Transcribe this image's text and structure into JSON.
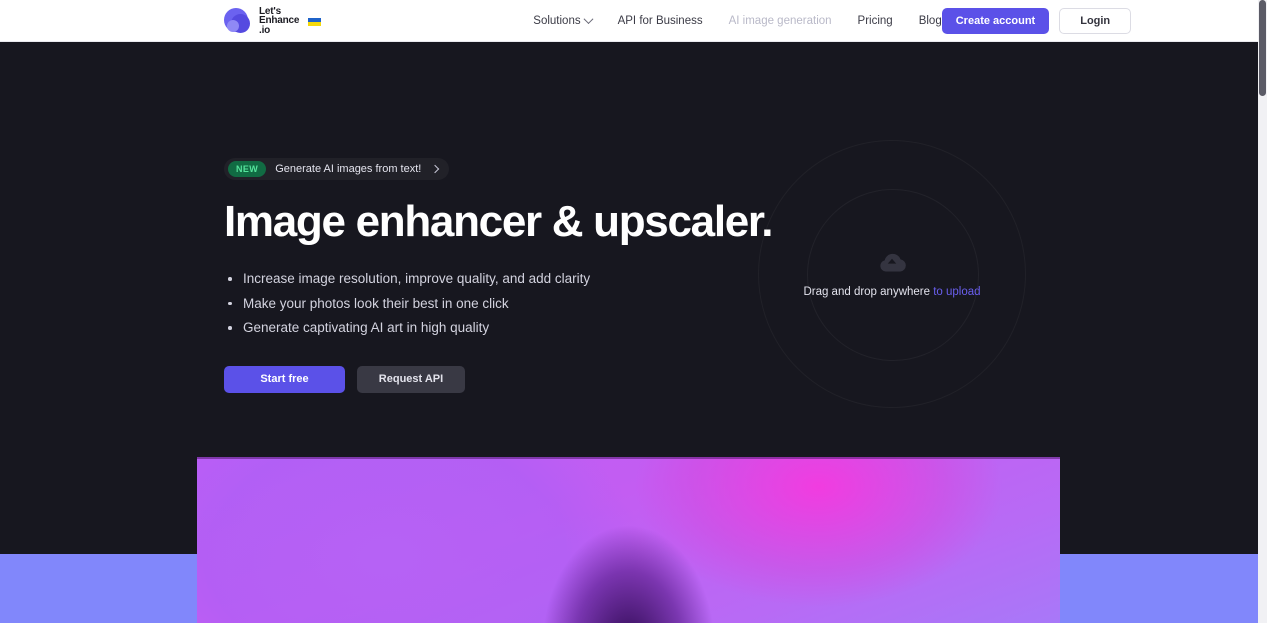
{
  "header": {
    "logo": {
      "line1": "Let's",
      "line2": "Enhance",
      "line3": ".io",
      "icon": "lets-enhance-logo"
    },
    "nav": [
      {
        "label": "Solutions",
        "has_chevron": true,
        "muted": false
      },
      {
        "label": "API for Business",
        "has_chevron": false,
        "muted": false
      },
      {
        "label": "AI image generation",
        "has_chevron": false,
        "muted": true
      },
      {
        "label": "Pricing",
        "has_chevron": false,
        "muted": false
      },
      {
        "label": "Blog",
        "has_chevron": false,
        "muted": false
      }
    ],
    "create_account_label": "Create account",
    "login_label": "Login"
  },
  "hero": {
    "badge": {
      "tag": "NEW",
      "text": "Generate AI images from text!"
    },
    "headline": "Image enhancer & upscaler.",
    "bullets": [
      "Increase image resolution, improve quality, and add clarity",
      "Make your photos look their best in one click",
      "Generate captivating AI art in high quality"
    ],
    "start_free_label": "Start free",
    "request_api_label": "Request API",
    "dropzone": {
      "icon": "cloud-upload-icon",
      "text": "Drag and drop anywhere",
      "link": "to upload"
    }
  },
  "colors": {
    "accent_purple": "#5b51e8",
    "link_purple": "#6a5fee",
    "badge_green_bg": "#116b43",
    "badge_green_text": "#55e39c",
    "page_dark": "#17171f",
    "header_white": "#ffffff",
    "blue_band": "#8187fb"
  }
}
